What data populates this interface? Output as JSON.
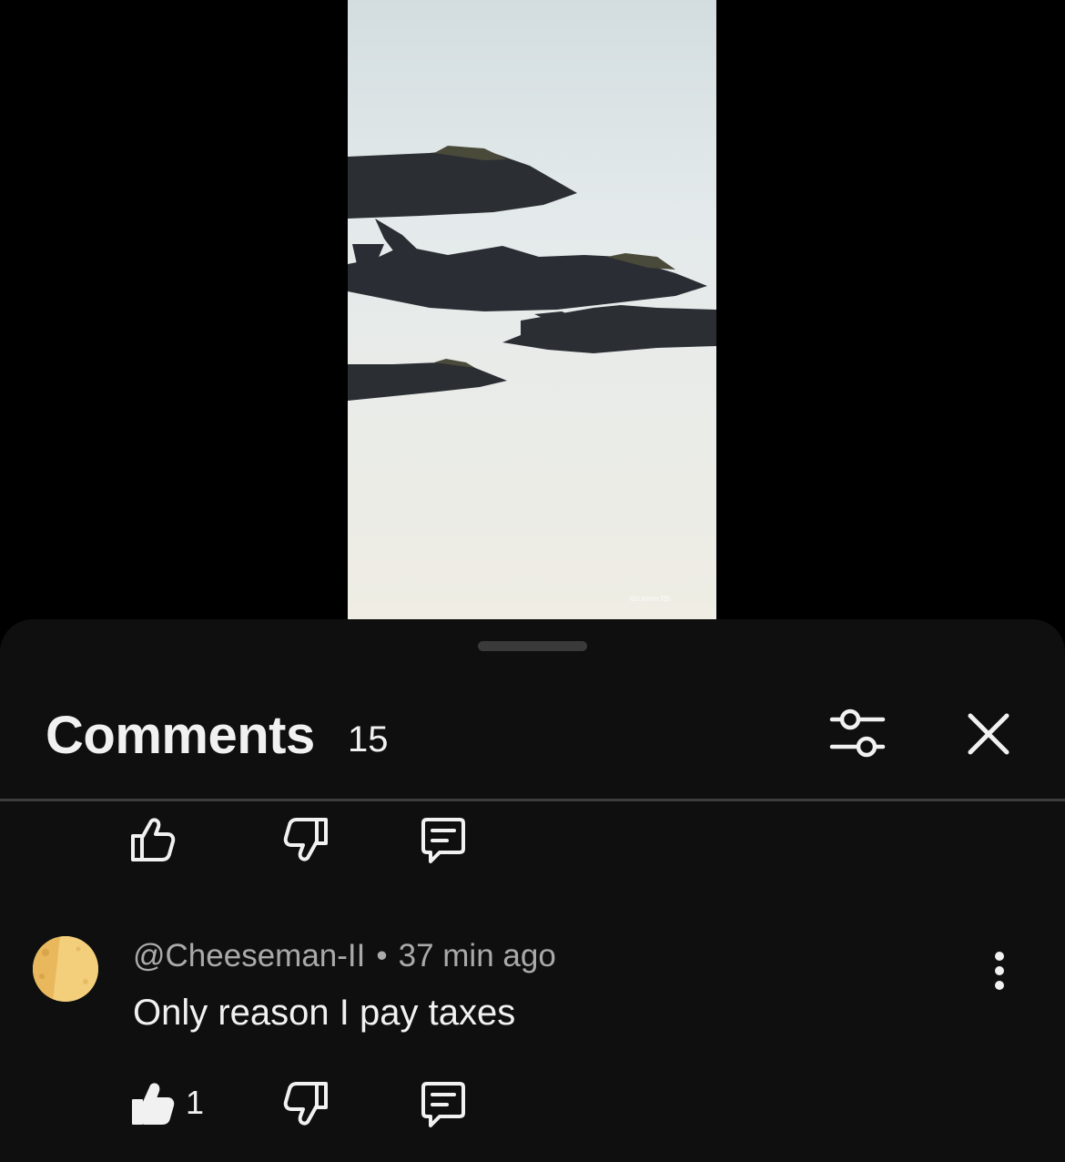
{
  "video": {
    "watermark": "rbn.kevin.f35"
  },
  "comments_panel": {
    "title": "Comments",
    "count": "15",
    "filter_icon": "sliders-icon",
    "close_icon": "close-icon"
  },
  "previous_comment_actions": {
    "like_icon": "thumbs-up-outline-icon",
    "dislike_icon": "thumbs-down-outline-icon",
    "reply_icon": "reply-comment-icon"
  },
  "comment": {
    "author": "@Cheeseman-II",
    "separator": "•",
    "time": "37 min ago",
    "text": "Only reason I pay taxes",
    "likes": "1",
    "liked": true,
    "more_icon": "vertical-ellipsis-icon",
    "avatar_color": "#f3cf7c"
  },
  "colors": {
    "sheet_bg": "#0f0f0f",
    "text_primary": "#f1f1f1",
    "text_secondary": "#aaaaaa"
  }
}
